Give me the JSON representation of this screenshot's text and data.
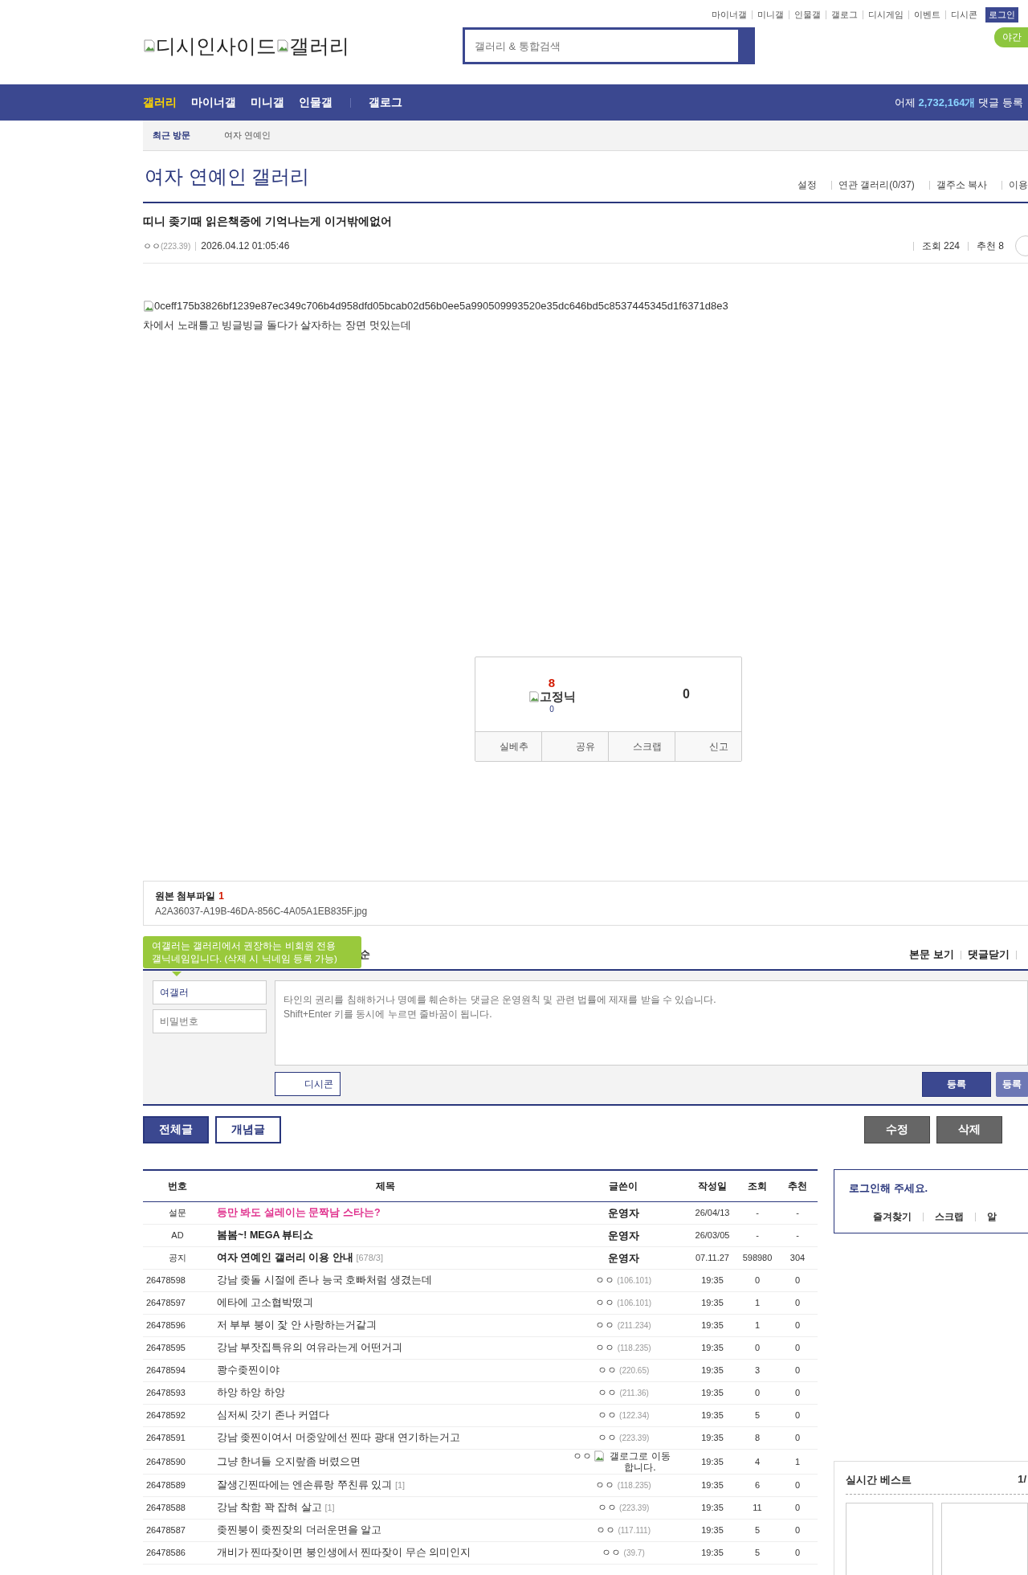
{
  "top_links": [
    "마이너갤",
    "미니갤",
    "인물갤",
    "갤로그",
    "디시게임",
    "이벤트",
    "디시콘"
  ],
  "login_button": "로그인",
  "night_toggle": "야간",
  "logo": {
    "site": "디시인사이드",
    "section": "갤러리"
  },
  "search": {
    "placeholder": "갤러리 & 통합검색"
  },
  "nav": [
    {
      "label": "갤러리",
      "selected": true
    },
    {
      "label": "마이너갤",
      "selected": false
    },
    {
      "label": "미니갤",
      "selected": false
    },
    {
      "label": "인물갤",
      "selected": false
    },
    {
      "label": "갤로그",
      "selected": false
    }
  ],
  "nav_stat": {
    "prefix": "어제",
    "count": "2,732,164개",
    "suffix": "댓글 등록"
  },
  "recent": {
    "label": "최근 방문",
    "items": [
      "여자 연예인"
    ]
  },
  "gallery": {
    "title": "여자 연예인 갤러리",
    "menu": [
      "설정",
      "연관 갤러리(0/37)",
      "갤주소 복사",
      "이용"
    ]
  },
  "post": {
    "title": "띠니 좆기때 읽은책중에 기억나는게 이거밖에없어",
    "writer": "ㅇㅇ",
    "ip": "(223.39)",
    "date": "2026.04.12 01:05:46",
    "views": "조회 224",
    "recommends": "추천 8",
    "image_alt": "0ceff175b3826bf1239e87ec349c706b4d958dfd05bcab02d56b0ee5a990509993520e35dc646bd5c8537445345d1f6371d8e3",
    "body": "차에서 노래틀고 빙글빙글 돌다가 살자하는 장면 멋있는데"
  },
  "vote": {
    "up": "8",
    "fixed_label": "고정닉",
    "fixed_count": "0",
    "down": "0",
    "actions": [
      "실베추",
      "공유",
      "스크랩",
      "신고"
    ]
  },
  "attachment": {
    "label": "원본 첨부파일",
    "count": "1",
    "file": "A2A36037-A19B-46DA-856C-4A05A1EB835F.jpg"
  },
  "comments": {
    "header_fragment": "순",
    "tooltip": "여갤러는 갤러리에서 권장하는 비회원 전용 갤닉네임입니다. (삭제 시 닉네임 등록 가능)",
    "links": [
      "본문 보기",
      "댓글닫기"
    ],
    "name_value": "여갤러",
    "password_placeholder": "비밀번호",
    "textarea_placeholder": "타인의 권리를 침해하거나 명예를 훼손하는 댓글은 운영원칙 및 관련 법률에 제재를 받을 수 있습니다.\nShift+Enter 키를 동시에 누르면 줄바꿈이 됩니다.",
    "dccon": "디시콘",
    "submit": "등록",
    "submit2": "등록"
  },
  "list_tabs": [
    {
      "label": "전체글",
      "selected": true
    },
    {
      "label": "개념글",
      "selected": false
    }
  ],
  "list_actions": [
    "수정",
    "삭제"
  ],
  "table": {
    "columns": [
      "번호",
      "제목",
      "글쓴이",
      "작성일",
      "조회",
      "추천"
    ],
    "rows": [
      {
        "kind": "survey",
        "num": "설문",
        "title": "등만 봐도 설레이는 문짝남 스타는?",
        "writer": "운영자",
        "date": "26/04/13",
        "views": "-",
        "rec": "-"
      },
      {
        "kind": "ad",
        "num": "AD",
        "title": "봄봄~! MEGA 뷰티쇼",
        "writer": "운영자",
        "date": "26/03/05",
        "views": "-",
        "rec": "-"
      },
      {
        "kind": "notice",
        "num": "공지",
        "title": "여자 연예인 갤러리 이용 안내",
        "stats": "[678/3]",
        "writer": "운영자",
        "date": "07.11.27",
        "views": "598980",
        "rec": "304"
      },
      {
        "kind": "post",
        "num": "26478598",
        "title": "강남 좆돌 시절에 존나 능국 호빠처럼 생겼는데",
        "writer": "ㅇㅇ",
        "ip": "(106.101)",
        "date": "19:35",
        "views": "0",
        "rec": "0"
      },
      {
        "kind": "post",
        "num": "26478597",
        "title": "에타에 고소협박떴긔",
        "writer": "ㅇㅇ",
        "ip": "(106.101)",
        "date": "19:35",
        "views": "1",
        "rec": "0"
      },
      {
        "kind": "post",
        "num": "26478596",
        "title": "저 부부 붕이 잧 안 사랑하는거같긔",
        "writer": "ㅇㅇ",
        "ip": "(211.234)",
        "date": "19:35",
        "views": "1",
        "rec": "0"
      },
      {
        "kind": "post",
        "num": "26478595",
        "title": "강남 부잣집특유의 여유라는게 어떤거긔",
        "writer": "ㅇㅇ",
        "ip": "(118.235)",
        "date": "19:35",
        "views": "0",
        "rec": "0"
      },
      {
        "kind": "post",
        "num": "26478594",
        "title": "쾅수좆찐이야",
        "writer": "ㅇㅇ",
        "ip": "(220.65)",
        "date": "19:35",
        "views": "3",
        "rec": "0"
      },
      {
        "kind": "post",
        "num": "26478593",
        "title": "하앙 하앙 하앙",
        "writer": "ㅇㅇ",
        "ip": "(211.36)",
        "date": "19:35",
        "views": "0",
        "rec": "0"
      },
      {
        "kind": "post",
        "num": "26478592",
        "title": "심저씨 갓기 존나 커엽다",
        "writer": "ㅇㅇ",
        "ip": "(122.34)",
        "date": "19:35",
        "views": "5",
        "rec": "0"
      },
      {
        "kind": "post",
        "num": "26478591",
        "title": "강남 좆찐이여서 머중앞에선 찐따 광대 연기하는거고",
        "writer": "ㅇㅇ",
        "ip": "(223.39)",
        "date": "19:35",
        "views": "8",
        "rec": "0"
      },
      {
        "kind": "gallog",
        "num": "26478590",
        "title": "그냥 한녀들 오지랖좀 버렸으면",
        "writer": "ㅇㅇ",
        "gallog": "갤로그로 이동합니다.",
        "date": "19:35",
        "views": "4",
        "rec": "1"
      },
      {
        "kind": "post",
        "num": "26478589",
        "title": "잘생긴찐따에는 엔손류랑 쭈친류 있긔",
        "reply": "[1]",
        "writer": "ㅇㅇ",
        "ip": "(118.235)",
        "date": "19:35",
        "views": "6",
        "rec": "0"
      },
      {
        "kind": "post",
        "num": "26478588",
        "title": "강남 착함 꽉 잡혀 살고",
        "reply": "[1]",
        "writer": "ㅇㅇ",
        "ip": "(223.39)",
        "date": "19:35",
        "views": "11",
        "rec": "0"
      },
      {
        "kind": "post",
        "num": "26478587",
        "title": "좆찐붕이 좆찐잦의 더러운면을 알고",
        "writer": "ㅇㅇ",
        "ip": "(117.111)",
        "date": "19:35",
        "views": "5",
        "rec": "0"
      },
      {
        "kind": "post",
        "num": "26478586",
        "title": "개비가 찐따잦이면 붕인생에서 찐따잦이 무슨 의미인지",
        "writer": "ㅇㅇ",
        "ip": "(39.7)",
        "date": "19:35",
        "views": "5",
        "rec": "0"
      }
    ]
  },
  "login_box": {
    "title": "로그인해 주세요.",
    "links": [
      "즐겨찾기",
      "스크랩",
      "알"
    ]
  },
  "best": {
    "title": "실시간 베스트",
    "page": "1/"
  }
}
